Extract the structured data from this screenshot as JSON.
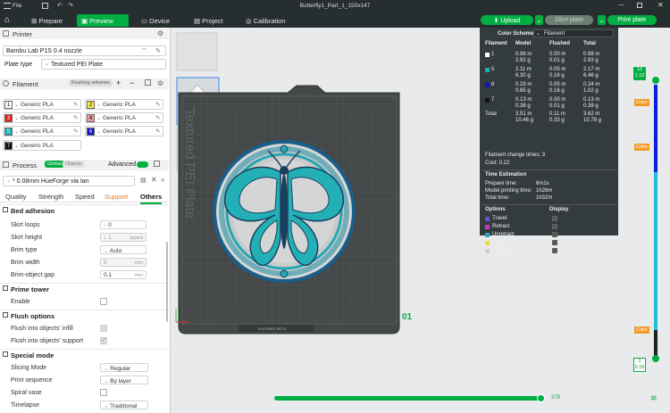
{
  "window": {
    "title": "Butterfly1_Part_1_150x147",
    "menu": "File"
  },
  "tabs": [
    {
      "label": "Prepare"
    },
    {
      "label": "Preview"
    },
    {
      "label": "Device"
    },
    {
      "label": "Project"
    },
    {
      "label": "Calibration"
    }
  ],
  "actions": {
    "upload": "Upload",
    "slice": "Slice plate",
    "print": "Print plate"
  },
  "printer": {
    "heading": "Printer",
    "name": "Bambu Lab P1S 0.4 nozzle",
    "plate_type_label": "Plate type",
    "plate_type": "Textured PEI Plate"
  },
  "filament": {
    "heading": "Filament",
    "flushing": "Flushing volumes",
    "slots": [
      {
        "num": "1",
        "name": "Generic PLA",
        "color": "#ffffff",
        "text": "#000000"
      },
      {
        "num": "2",
        "name": "Generic PLA",
        "color": "#f5e742",
        "text": "#000000"
      },
      {
        "num": "3",
        "name": "Generic PLA",
        "color": "#e02020",
        "text": "#ffffff"
      },
      {
        "num": "4",
        "name": "Generic PLA",
        "color": "#f29b9b",
        "text": "#000000"
      },
      {
        "num": "5",
        "name": "Generic PLA",
        "color": "#1ab1b8",
        "text": "#ffffff"
      },
      {
        "num": "6",
        "name": "Generic PLA",
        "color": "#1010c8",
        "text": "#ffffff"
      },
      {
        "num": "7",
        "name": "Generic PLA",
        "color": "#111111",
        "text": "#ffffff"
      }
    ]
  },
  "process": {
    "heading": "Process",
    "global": "Global",
    "objects": "Objects",
    "advanced": "Advanced",
    "preset": "* 0.08mm HueForge via Ian",
    "tabs": [
      "Quality",
      "Strength",
      "Speed",
      "Support",
      "Others"
    ]
  },
  "settings": {
    "bed_adhesion": {
      "title": "Bed adhesion",
      "skirt_loops": {
        "label": "Skirt loops",
        "value": "0"
      },
      "skirt_height": {
        "label": "Skirt height",
        "value": "1",
        "unit": "layers"
      },
      "brim_type": {
        "label": "Brim type",
        "value": "Auto"
      },
      "brim_width": {
        "label": "Brim width",
        "value": "5",
        "unit": "mm"
      },
      "brim_gap": {
        "label": "Brim-object gap",
        "value": "0.1",
        "unit": "mm"
      }
    },
    "prime_tower": {
      "title": "Prime tower",
      "enable": "Enable"
    },
    "flush": {
      "title": "Flush options",
      "infill": "Flush into objects' infill",
      "support": "Flush into objects' support"
    },
    "special": {
      "title": "Special mode",
      "slicing_mode": {
        "label": "Slicing Mode",
        "value": "Regular"
      },
      "print_sequence": {
        "label": "Print sequence",
        "value": "By layer"
      },
      "spiral": "Spiral vase",
      "timelapse": {
        "label": "Timelapse",
        "value": "Traditional"
      }
    }
  },
  "stats": {
    "color_scheme_label": "Color Scheme",
    "color_scheme": "Filament",
    "headers": [
      "Filament",
      "Model",
      "Flushed",
      "Total"
    ],
    "rows": [
      {
        "id": "1",
        "color": "#ffffff",
        "model": [
          "0.98 m",
          "2.92 g"
        ],
        "flushed": [
          "0.00 m",
          "0.01 g"
        ],
        "total": [
          "0.98 m",
          "2.93 g"
        ]
      },
      {
        "id": "5",
        "color": "#1ab1b8",
        "model": [
          "2.11 m",
          "6.30 g"
        ],
        "flushed": [
          "0.05 m",
          "0.16 g"
        ],
        "total": [
          "2.17 m",
          "6.46 g"
        ]
      },
      {
        "id": "6",
        "color": "#1010c8",
        "model": [
          "0.29 m",
          "0.85 g"
        ],
        "flushed": [
          "0.05 m",
          "0.16 g"
        ],
        "total": [
          "0.34 m",
          "1.02 g"
        ]
      },
      {
        "id": "7",
        "color": "#111111",
        "model": [
          "0.13 m",
          "0.38 g"
        ],
        "flushed": [
          "0.00 m",
          "0.01 g"
        ],
        "total": [
          "0.13 m",
          "0.38 g"
        ]
      }
    ],
    "total": {
      "label": "Total",
      "model": [
        "3.51 m",
        "10.46 g"
      ],
      "flushed": [
        "0.11 m",
        "0.33 g"
      ],
      "total": [
        "3.62 m",
        "10.79 g"
      ]
    },
    "change_times": "Filament change times:  3",
    "cost": "Cost:  0.22",
    "time_heading": "Time Estimation",
    "times": [
      {
        "label": "Prepare time:",
        "value": "6m1s"
      },
      {
        "label": "Model printing time:",
        "value": "1h26m"
      },
      {
        "label": "Total time:",
        "value": "1h32m"
      }
    ],
    "options_heading": "Options",
    "display_heading": "Display",
    "options": [
      {
        "label": "Travel",
        "color": "#6b4ccf"
      },
      {
        "label": "Retract",
        "color": "#cc33cc"
      },
      {
        "label": "Unretract",
        "color": "#3aa3c8"
      },
      {
        "label": "Wipe",
        "color": "#e8e040"
      },
      {
        "label": "Seams",
        "color": "#d0d0d0"
      }
    ]
  },
  "viewport": {
    "plate_text": "Textured PEI Plate",
    "plate_index": "01",
    "layer_top": "13",
    "height_top": "1.12",
    "layer_bottom": "1",
    "height_bottom": "0.16",
    "tag_color": "Color",
    "move_value": "378",
    "move_progress": 0.99
  }
}
